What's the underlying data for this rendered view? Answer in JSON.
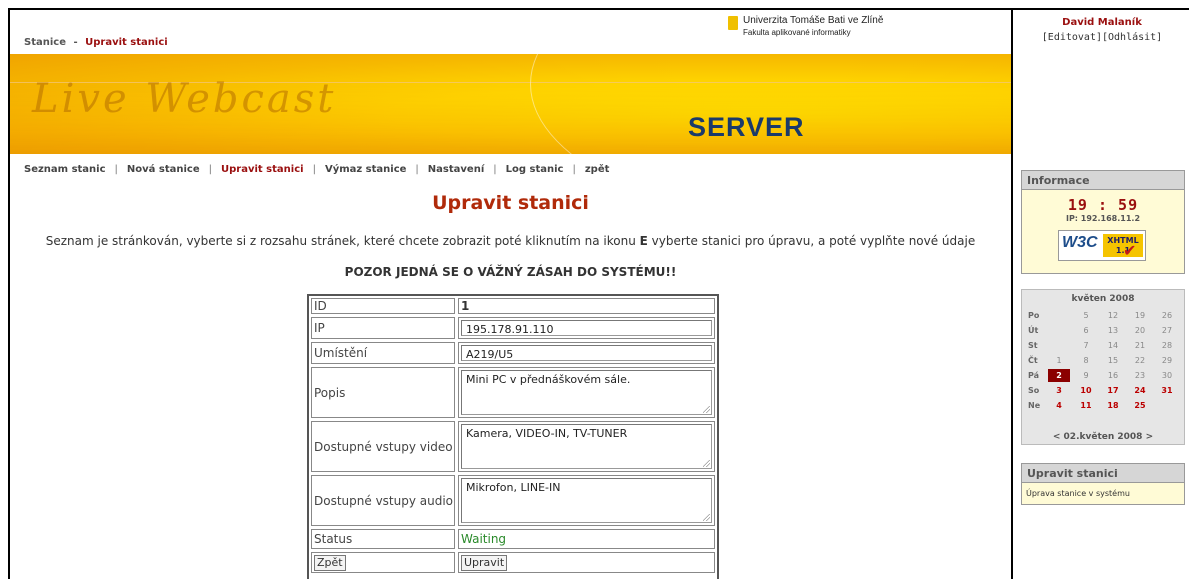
{
  "breadcrumb": {
    "root": "Stanice",
    "separator": "-",
    "current": "Upravit stanici"
  },
  "university": {
    "name": "Univerzita Tomáše Bati ve Zlíně",
    "faculty": "Fakulta aplikované informatiky"
  },
  "banner": {
    "title": "Live Webcast",
    "subtitle": "SERVER"
  },
  "nav": [
    {
      "label": "Seznam stanic"
    },
    {
      "label": "Nová stanice"
    },
    {
      "label": "Upravit stanici",
      "active": true
    },
    {
      "label": "Výmaz stanice"
    },
    {
      "label": "Nastavení"
    },
    {
      "label": "Log stanic"
    },
    {
      "label": "zpět"
    }
  ],
  "nav_separator": "|",
  "page": {
    "title": "Upravit stanici",
    "description": "Seznam je stránkován, vyberte si z rozsahu stránek, které chcete zobrazit poté kliknutím na ikonu",
    "description_key": "E",
    "description_rest": "vyberte stanici pro úpravu, a poté vyplňte nové údaje",
    "warning": "POZOR JEDNÁ SE O VÁŽNÝ ZÁSAH DO SYSTÉMU!!"
  },
  "form": {
    "id_label": "ID",
    "id_value": "1",
    "ip_label": "IP",
    "ip_value": "195.178.91.110",
    "location_label": "Umístění",
    "location_value": "A219/U5",
    "description_label": "Popis",
    "description_value": "Mini PC v přednáškovém sále.",
    "video_label": "Dostupné vstupy video",
    "video_value": "Kamera, VIDEO-IN, TV-TUNER",
    "audio_label": "Dostupné vstupy audio",
    "audio_value": "Mikrofon, LINE-IN",
    "status_label": "Status",
    "status_value": "Waiting",
    "status_color": "#2a8a2a",
    "back_button": "Zpět",
    "submit_button": "Upravit"
  },
  "user": {
    "name": "David Malaník",
    "links": "[Editovat][Odhlásit]"
  },
  "info": {
    "header": "Informace",
    "time": "19 : 59",
    "ip": "IP: 192.168.11.2",
    "badge_left": "W3C",
    "badge_right_1": "XHTML",
    "badge_right_2": "1.1"
  },
  "calendar": {
    "title": "květen 2008",
    "rows": [
      {
        "day": "Po",
        "dates": [
          "",
          "5",
          "12",
          "19",
          "26"
        ]
      },
      {
        "day": "Út",
        "dates": [
          "",
          "6",
          "13",
          "20",
          "27"
        ]
      },
      {
        "day": "St",
        "dates": [
          "",
          "7",
          "14",
          "21",
          "28"
        ]
      },
      {
        "day": "Čt",
        "dates": [
          "1",
          "8",
          "15",
          "22",
          "29"
        ]
      },
      {
        "day": "Pá",
        "dates": [
          "2",
          "9",
          "16",
          "23",
          "30"
        ]
      },
      {
        "day": "So",
        "dates": [
          "3",
          "10",
          "17",
          "24",
          "31"
        ]
      },
      {
        "day": "Ne",
        "dates": [
          "4",
          "11",
          "18",
          "25",
          ""
        ]
      }
    ],
    "today": "2",
    "nav": "< 02.květen 2008 >"
  },
  "edit_box": {
    "header": "Upravit stanici",
    "text": "Úprava stanice v systému"
  },
  "colors": {
    "accent_red": "#9a0f0f",
    "banner_yellow": "#ffd600",
    "server_blue": "#1a3a6a"
  }
}
